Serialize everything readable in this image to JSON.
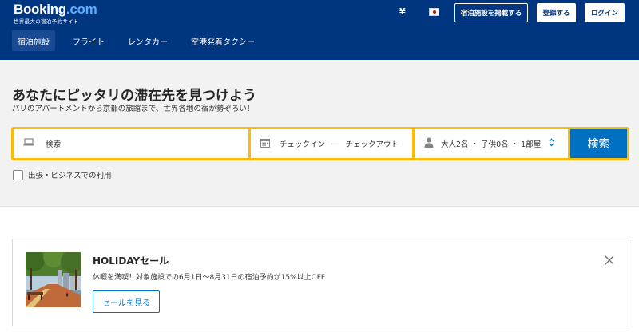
{
  "header": {
    "logo": {
      "main": "Booking",
      "suffix": ".com",
      "tagline": "世界最大の宿泊予約サイト"
    },
    "currency": "¥",
    "flag_icon": "japan-flag-icon",
    "list_property_label": "宿泊施設を掲載する",
    "register_label": "登録する",
    "login_label": "ログイン"
  },
  "nav": {
    "items": [
      {
        "label": "宿泊施設",
        "active": true
      },
      {
        "label": "フライト",
        "active": false
      },
      {
        "label": "レンタカー",
        "active": false
      },
      {
        "label": "空港発着タクシー",
        "active": false
      }
    ]
  },
  "hero": {
    "title": "あなたにピッタリの滞在先を見つけよう",
    "subtitle": "パリのアパートメントから京都の旅館まで、世界各地の宿が勢ぞろい！"
  },
  "search": {
    "destination_placeholder": "検索",
    "checkin_label": "チェックイン",
    "date_separator": "—",
    "checkout_label": "チェックアウト",
    "guests_label": "大人2名 ・ 子供0名 ・ 1部屋",
    "submit_label": "検索",
    "business_label": "出張・ビジネスでの利用"
  },
  "promo": {
    "title": "HOLIDAYセール",
    "text": "休暇を満喫！対象施設での6月1日～8月31日の宿泊予約が15%以上OFF",
    "button_label": "セールを見る"
  },
  "colors": {
    "brand_blue": "#003580",
    "accent_yellow": "#febb02",
    "button_blue": "#0071c2",
    "hero_bg": "#f2f2f2"
  }
}
